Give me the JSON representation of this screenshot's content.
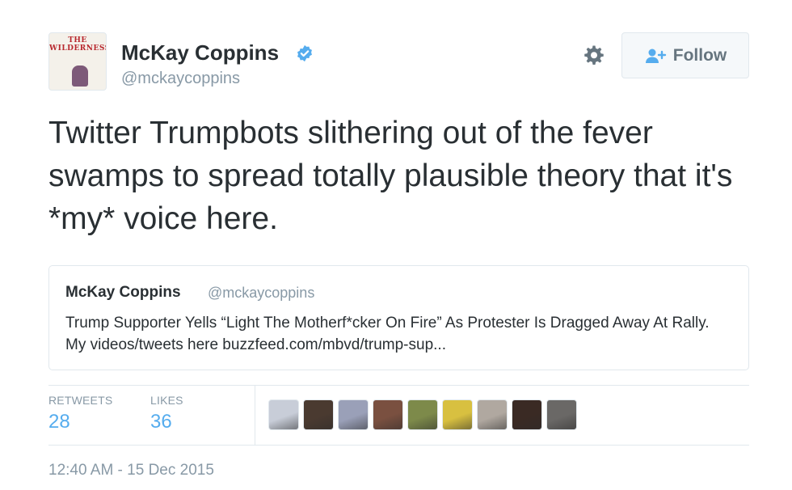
{
  "author": {
    "name": "McKay Coppins",
    "handle": "@mckaycoppins",
    "avatar_text": "THE WILDERNESS"
  },
  "follow_button": {
    "label": "Follow"
  },
  "tweet": {
    "text": "Twitter Trumpbots slithering out of the fever swamps to spread totally plausible theory that it's *my* voice here."
  },
  "quoted_tweet": {
    "name": "McKay Coppins",
    "handle": "@mckaycoppins",
    "text": "Trump Supporter Yells “Light The Motherf*cker On Fire” As Protester Is Dragged Away At Rally. My videos/tweets here  buzzfeed.com/mbvd/trump-sup..."
  },
  "stats": {
    "retweets_label": "RETWEETS",
    "retweets_value": "28",
    "likes_label": "LIKES",
    "likes_value": "36"
  },
  "liker_avatar_colors": [
    "#c8cdd8",
    "#4a3a30",
    "#9aa0b8",
    "#7a5040",
    "#7d8a4a",
    "#d8c040",
    "#b0a8a0",
    "#3a2a24",
    "#6a6866"
  ],
  "timestamp": "12:40 AM - 15 Dec 2015",
  "colors": {
    "accent": "#55acee",
    "muted": "#8899a6",
    "text": "#292f33",
    "verified": "#55acee"
  }
}
